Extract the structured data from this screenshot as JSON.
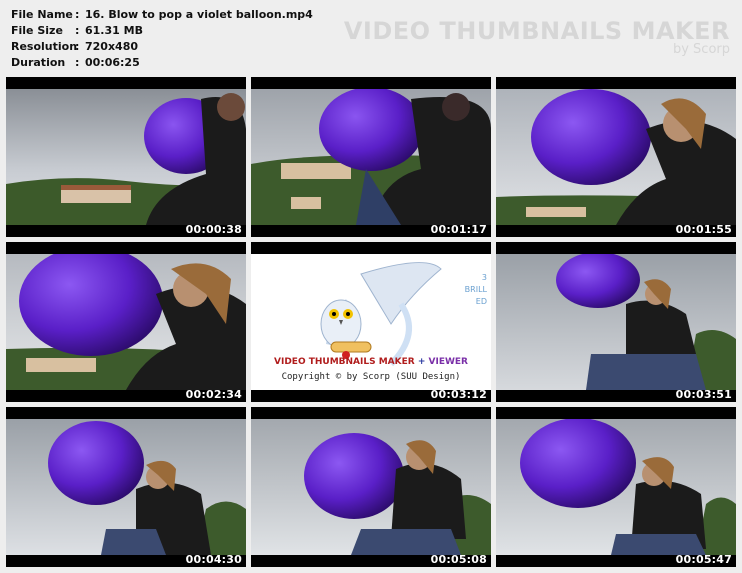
{
  "info": {
    "file_name_label": "File Name",
    "file_name": "16. Blow to pop a violet balloon.mp4",
    "file_size_label": "File Size",
    "file_size": "61.31 MB",
    "resolution_label": "Resolution",
    "resolution": "720x480",
    "duration_label": "Duration",
    "duration": "00:06:25",
    "separator": ":"
  },
  "brand": {
    "title": "VIDEO THUMBNAILS MAKER",
    "subtitle": "by Scorp"
  },
  "thumbnails": [
    {
      "timestamp": "00:00:38"
    },
    {
      "timestamp": "00:01:17"
    },
    {
      "timestamp": "00:01:55"
    },
    {
      "timestamp": "00:02:34"
    },
    {
      "timestamp": "00:03:12"
    },
    {
      "timestamp": "00:03:51"
    },
    {
      "timestamp": "00:04:30"
    },
    {
      "timestamp": "00:05:08"
    },
    {
      "timestamp": "00:05:47"
    }
  ],
  "logo_card": {
    "title_part1": "VIDEO THUMBNAILS MAKER",
    "title_plus": " + ",
    "title_part2": "VIEWER",
    "copyright": "Copyright © by Scorp (SUU Design)",
    "side_text_1": "3",
    "side_text_2": "BRILL",
    "side_text_3": "ED"
  },
  "colors": {
    "balloon": "#5a1fc8",
    "sky": "#c9ccd1",
    "jacket": "#1b1b1b",
    "hills": "#3c5a2a"
  }
}
